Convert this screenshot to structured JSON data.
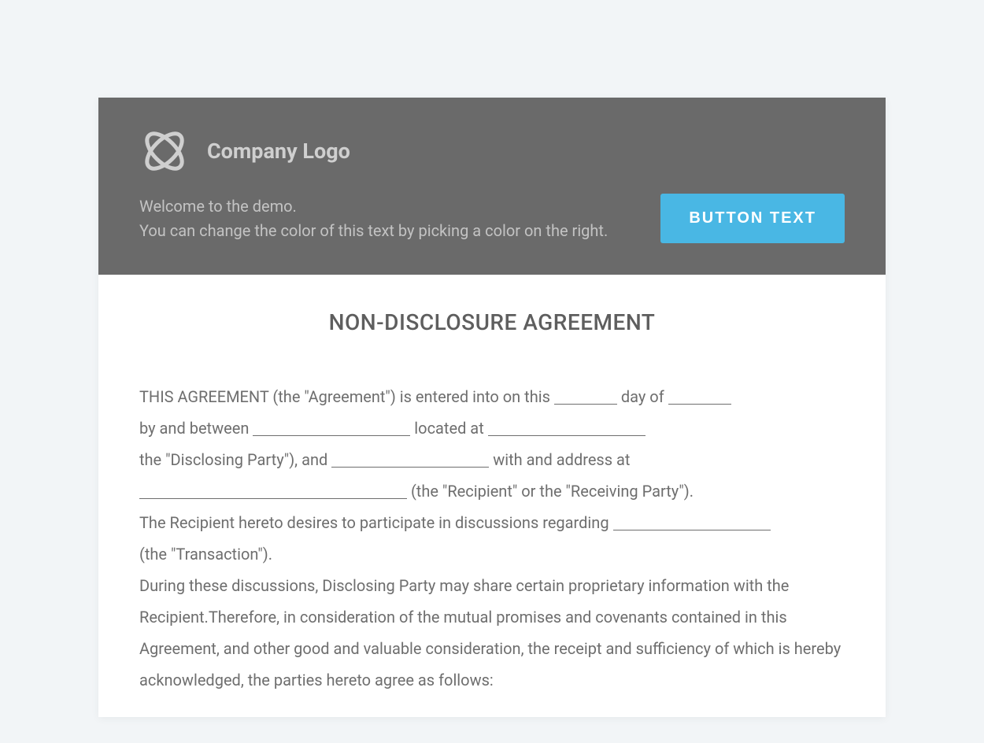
{
  "header": {
    "logo_text": "Company Logo",
    "welcome_line1": "Welcome to the demo.",
    "welcome_line2": "You can change the color of this text by picking a color on the right.",
    "button_label": "BUTTON TEXT"
  },
  "document": {
    "title": "NON-DISCLOSURE AGREEMENT",
    "body": {
      "p1_a": "THIS AGREEMENT (the \"Agreement\") is entered into on this ",
      "p1_b": " day of ",
      "p2_a": "by and between ",
      "p2_b": " located at ",
      "p3_a": "the \"Disclosing Party\"), and ",
      "p3_b": " with and address at ",
      "p4_b": " (the \"Recipient\" or the \"Receiving Party\").",
      "p5_a": "The Recipient hereto desires to participate in discussions regarding ",
      "p6": "(the \"Transaction\").",
      "p7": "During these discussions, Disclosing Party may share certain proprietary information with the Recipient.Therefore, in consideration of the mutual promises and covenants contained in this Agreement, and other good and valuable consideration, the receipt and sufficiency of which is hereby acknowledged, the parties hereto agree as follows:"
    }
  },
  "colors": {
    "header_bg": "#6a6a6a",
    "button_bg": "#49b7e4",
    "page_bg": "#f2f5f7"
  }
}
